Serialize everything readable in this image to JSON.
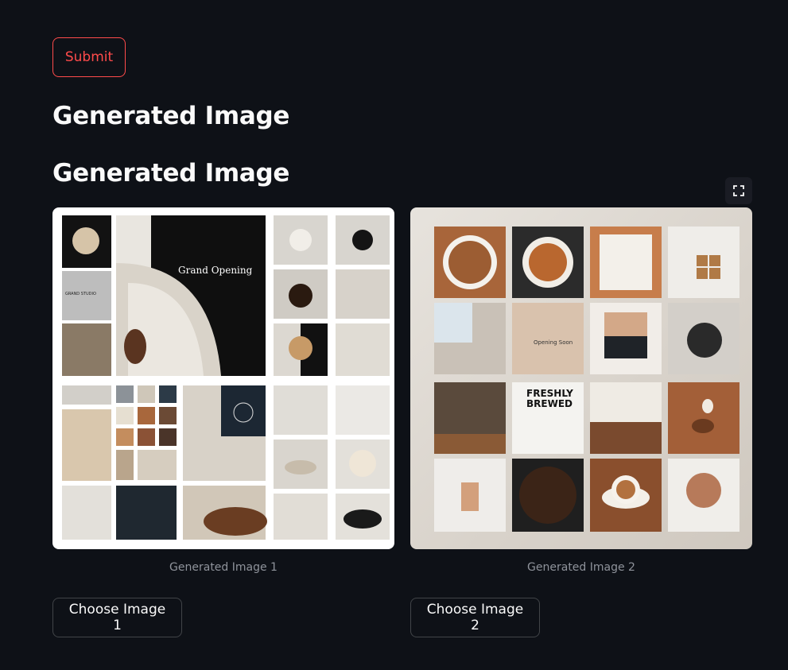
{
  "submit": {
    "label": "Submit"
  },
  "headings": [
    "Generated Image",
    "Generated Image"
  ],
  "images": [
    {
      "caption": "Generated Image 1",
      "choose_label": "Choose Image 1",
      "tile_texts": {
        "grand_opening": "Grand Opening",
        "studio": "GRAND STUDIO"
      }
    },
    {
      "caption": "Generated Image 2",
      "choose_label": "Choose Image 2",
      "tile_texts": {
        "opening_soon": "Opening Soon",
        "freshly": "FRESHLY",
        "brewed": "BREWED"
      }
    }
  ],
  "icons": {
    "expand": "fullscreen-icon"
  }
}
